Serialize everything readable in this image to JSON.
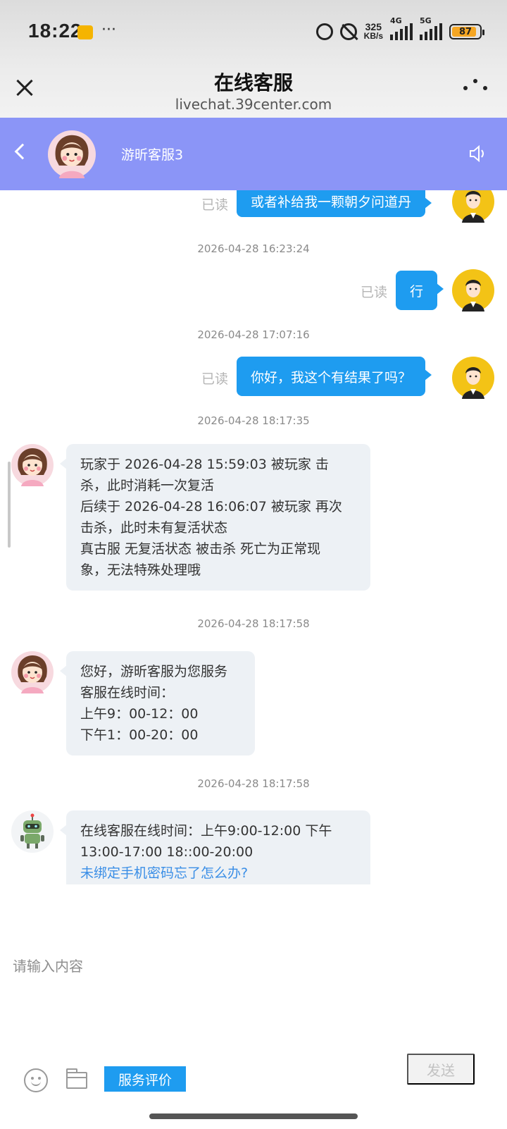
{
  "status_bar": {
    "time": "18:22",
    "net_speed_value": "325",
    "net_speed_unit": "KB/s",
    "sim1_tag": "4G",
    "sim2_tag": "5G",
    "battery": "87"
  },
  "browser": {
    "title": "在线客服",
    "url": "livechat.39center.com"
  },
  "chat_header": {
    "agent_name": "游昕客服3",
    "color": "#8b95f7"
  },
  "messages": {
    "m1": {
      "read": "已读",
      "text": "或者补给我一颗朝夕问道丹"
    },
    "ts1": "2026-04-28 16:23:24",
    "m2": {
      "read": "已读",
      "text": "行"
    },
    "ts2": "2026-04-28 17:07:16",
    "m3": {
      "read": "已读",
      "text": "你好，我这个有结果了吗？"
    },
    "ts3": "2026-04-28 18:17:35",
    "m4": {
      "lines": [
        "玩家于 2026-04-28 15:59:03 被玩家 击",
        "杀，此时消耗一次复活",
        "后续于 2026-04-28 16:06:07 被玩家 再次",
        "击杀，此时未有复活状态",
        "真古服 无复活状态 被击杀 死亡为正常现",
        "象，无法特殊处理哦"
      ]
    },
    "ts4": "2026-04-28 18:17:58",
    "m5": {
      "lines": [
        "您好，游昕客服为您服务",
        "客服在线时间：",
        "上午9：00-12：00",
        "下午1：00-20：00"
      ]
    },
    "ts5": "2026-04-28 18:17:58",
    "m6": {
      "lines": [
        "在线客服在线时间：上午9:00-12:00 下午",
        "13:00-17:00 18::00-20:00"
      ],
      "link": "未绑定手机密码忘了怎么办?"
    }
  },
  "input": {
    "placeholder": "请输入内容",
    "rate_label": "服务评价",
    "send_label": "发送"
  },
  "colors": {
    "outgoing_bubble": "#1e9cf0",
    "incoming_bubble": "#edf1f5",
    "link": "#3a8ee6"
  },
  "icons": [
    "close-icon",
    "more-icon",
    "back-icon",
    "speaker-icon",
    "emoji-icon",
    "folder-icon",
    "alarm-icon",
    "mute-icon"
  ]
}
